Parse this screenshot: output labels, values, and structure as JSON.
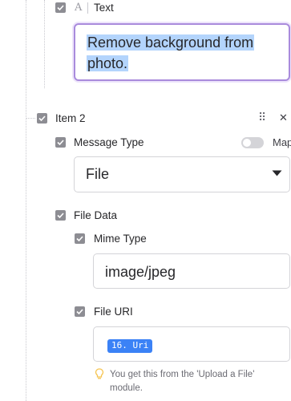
{
  "text_section": {
    "type_glyph": "A",
    "label": "Text",
    "value_line1": "Remove background from",
    "value_line2": "photo."
  },
  "item2": {
    "label": "Item 2",
    "drag_glyph": "⠿",
    "close_glyph": "✕",
    "message_type": {
      "label": "Message Type",
      "map_label": "Map",
      "selected": "File"
    },
    "file_data": {
      "label": "File Data",
      "mime_type": {
        "label": "Mime Type",
        "value": "image/jpeg"
      },
      "file_uri": {
        "label": "File URI",
        "pill": "16. Uri",
        "hint_line1": "You get this from the 'Upload a File'",
        "hint_line2": "module."
      }
    }
  },
  "colors": {
    "checkbox": "#8d8d93",
    "focus_border": "#a98bdc",
    "selection": "#b3d4fc",
    "pill": "#3b82f6",
    "hint_bulb": "#f5c451"
  }
}
